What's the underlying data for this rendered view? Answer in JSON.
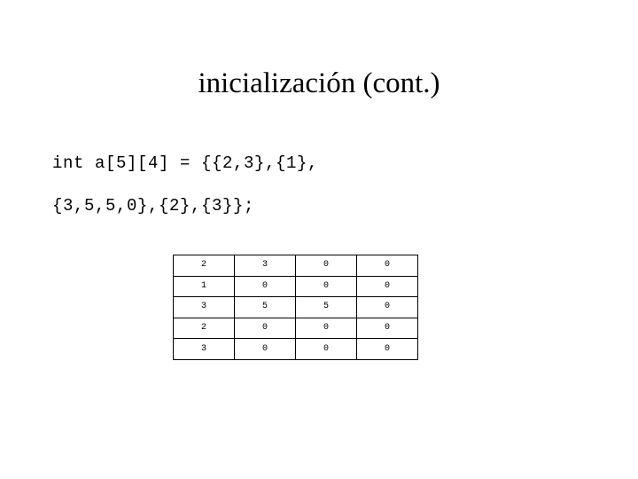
{
  "slide": {
    "title": "inicialización (cont.)",
    "background_color": "#ffffff",
    "text_color": "#000000"
  },
  "code": {
    "lines": [
      "int a[5][4] = {{2,3},{1},",
      "{3,5,5,0},{2},{3}};"
    ],
    "line_1": "int a[5][4] = {{2,3},{1},",
    "line_2": "{3,5,5,0},{2},{3}};"
  },
  "array_table": {
    "rows": 5,
    "cols": 4,
    "border_color": "#000000",
    "values": [
      [
        "2",
        "3",
        "0",
        "0"
      ],
      [
        "1",
        "0",
        "0",
        "0"
      ],
      [
        "3",
        "5",
        "5",
        "0"
      ],
      [
        "2",
        "0",
        "0",
        "0"
      ],
      [
        "3",
        "0",
        "0",
        "0"
      ]
    ]
  }
}
